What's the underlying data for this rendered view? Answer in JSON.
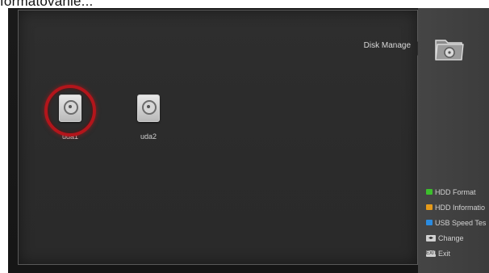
{
  "caption": "formatovanie...",
  "menu": {
    "title": "Disk Manage",
    "icon": "folder-disk-icon"
  },
  "disks": [
    {
      "label": "uda1",
      "selected": true,
      "icon": "hard-disk-icon"
    },
    {
      "label": "uda2",
      "selected": false,
      "icon": "hard-disk-icon"
    }
  ],
  "legend": [
    {
      "label": "HDD Format",
      "color": "#3cbf2c"
    },
    {
      "label": "HDD Informatio",
      "color": "#e59a1a"
    },
    {
      "label": "USB Speed Tes",
      "color": "#2a8be0"
    },
    {
      "label": "Change",
      "key": "◂▸"
    },
    {
      "label": "Exit",
      "key": "EXIT"
    }
  ],
  "colors": {
    "selection_ring": "#b3151b",
    "panel": "#2e2e2e",
    "side_panel": "#3f3f3f"
  }
}
